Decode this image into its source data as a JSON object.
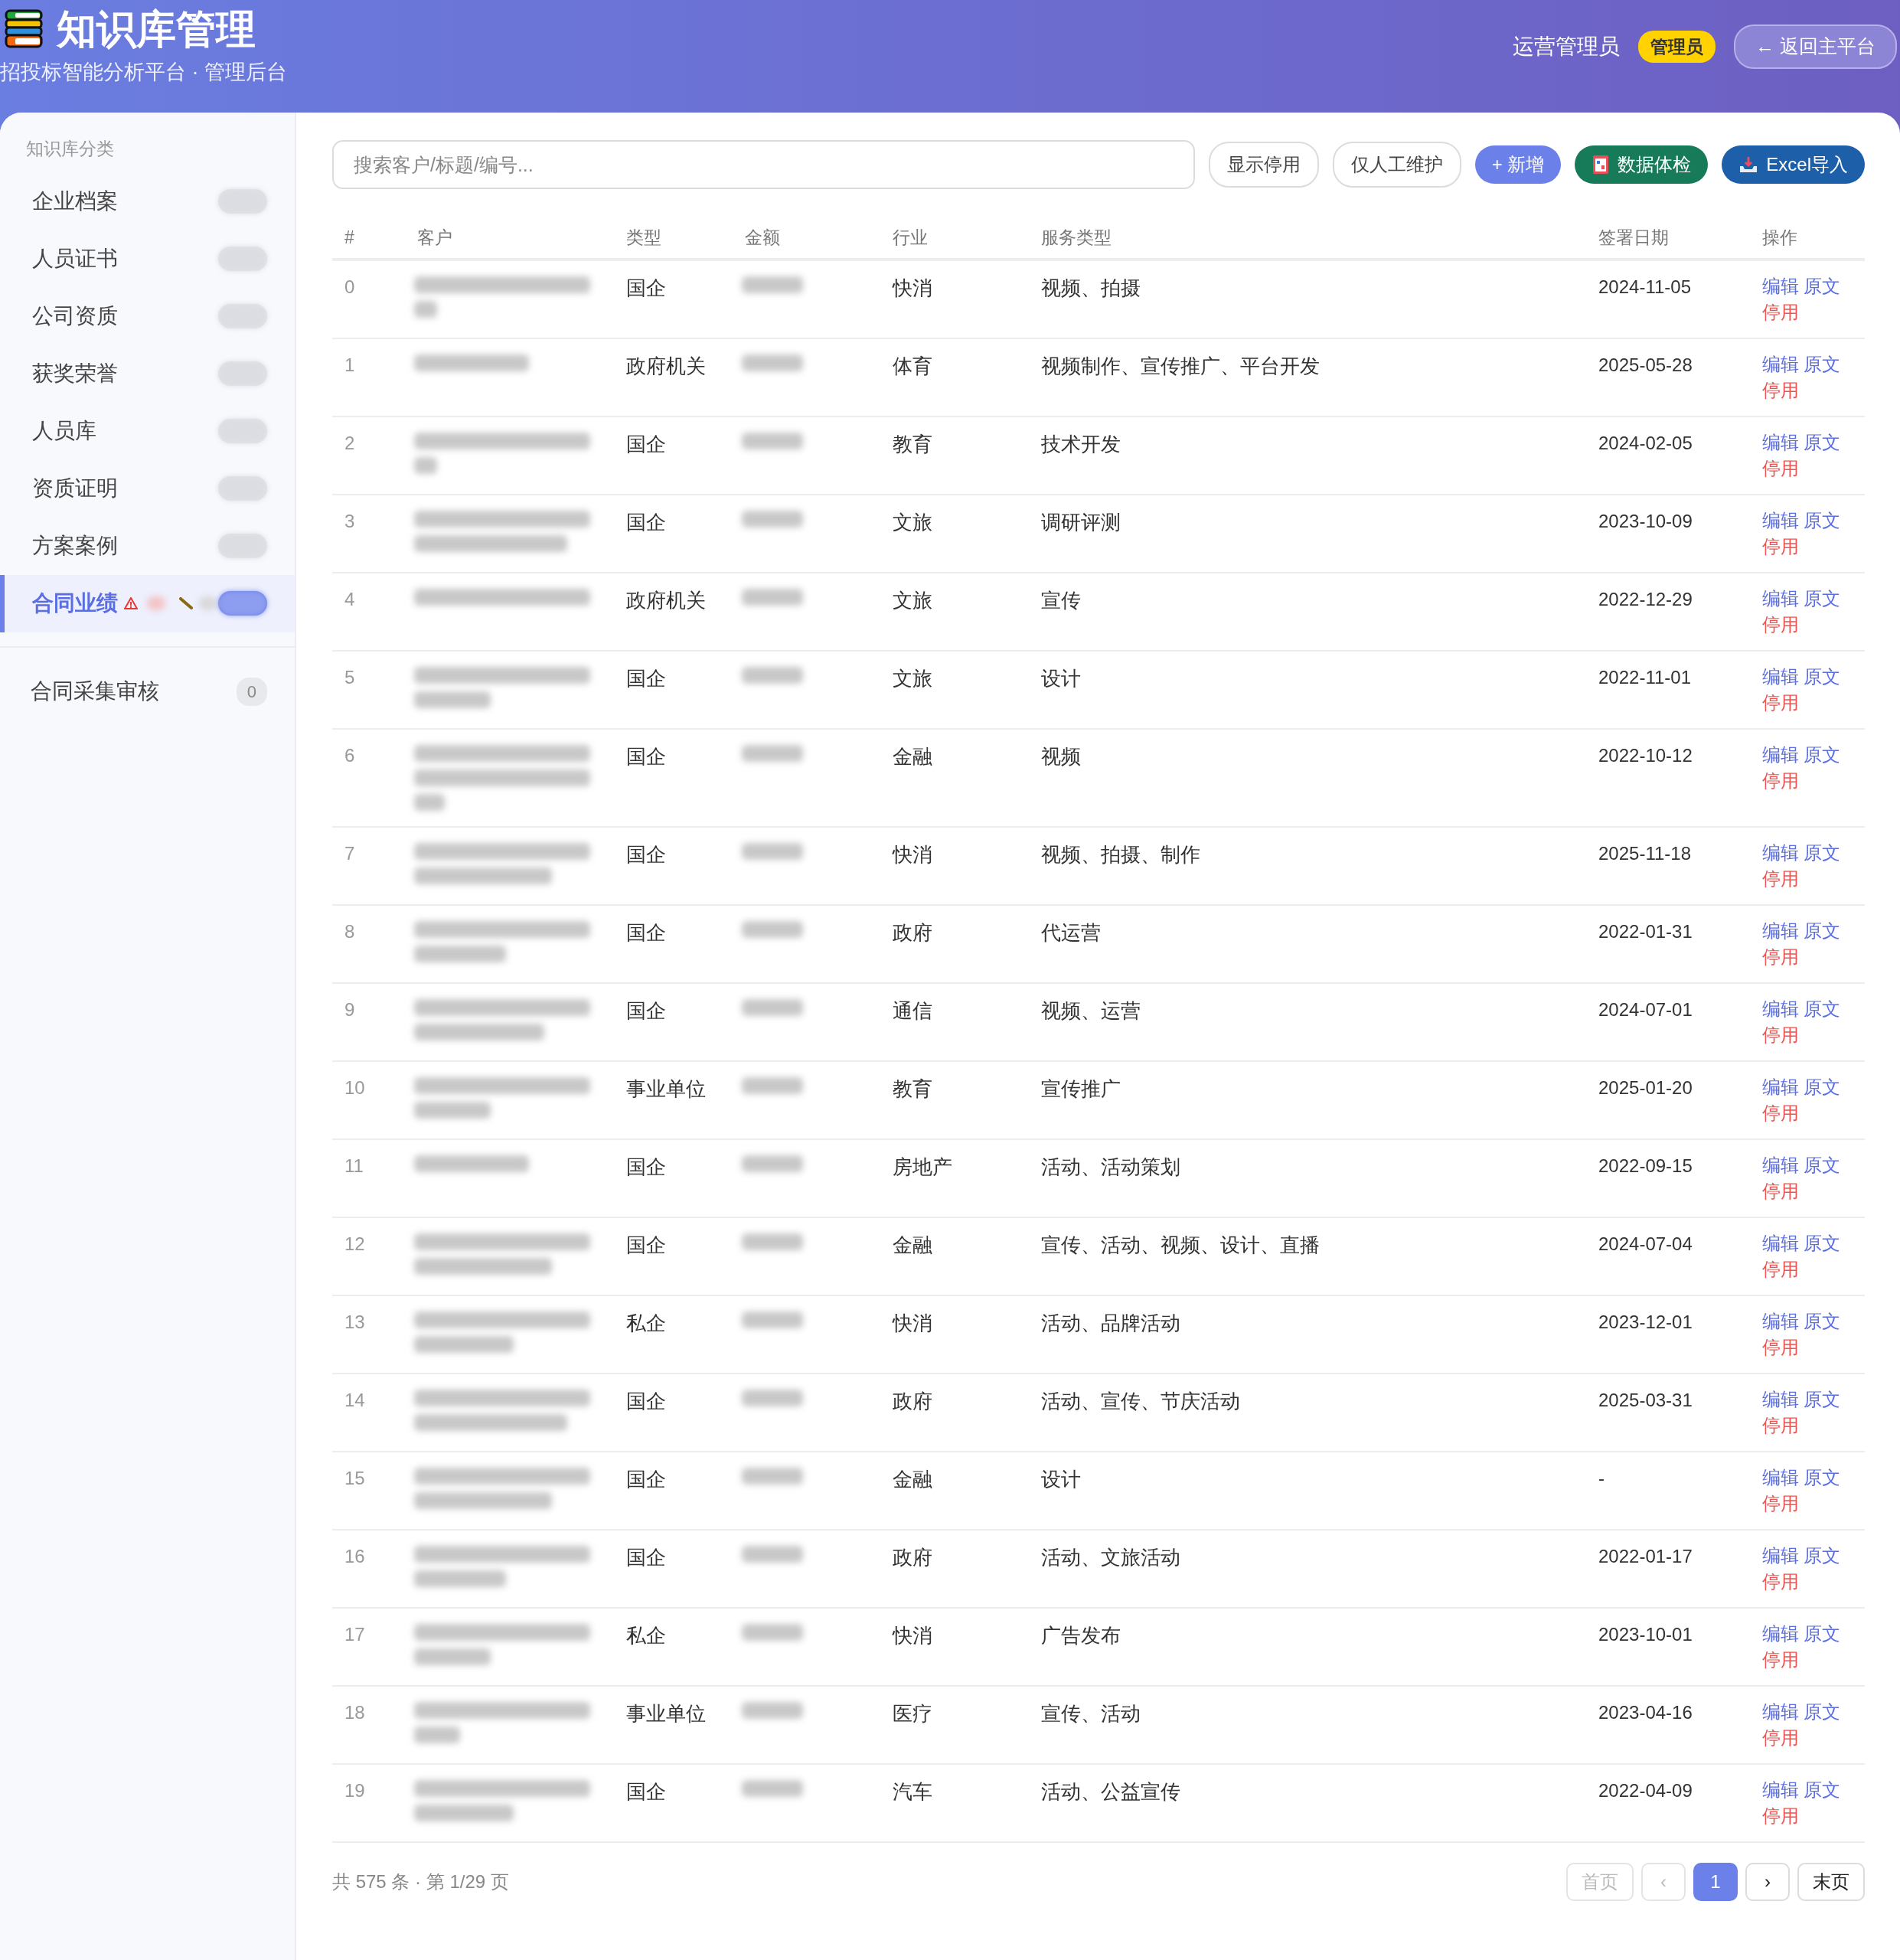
{
  "header": {
    "title": "知识库管理",
    "subtitle": "招投标智能分析平台 · 管理后台",
    "user": "运营管理员",
    "role_badge": "管理员",
    "back_button": "← 返回主平台"
  },
  "sidebar": {
    "heading": "知识库分类",
    "items": [
      {
        "label": "企业档案",
        "selected": false,
        "alert": false
      },
      {
        "label": "人员证书",
        "selected": false,
        "alert": false
      },
      {
        "label": "公司资质",
        "selected": false,
        "alert": false
      },
      {
        "label": "获奖荣誉",
        "selected": false,
        "alert": false
      },
      {
        "label": "人员库",
        "selected": false,
        "alert": false
      },
      {
        "label": "资质证明",
        "selected": false,
        "alert": false
      },
      {
        "label": "方案案例",
        "selected": false,
        "alert": false
      },
      {
        "label": "合同业绩",
        "selected": true,
        "alert": true
      }
    ],
    "review": {
      "label": "合同采集审核",
      "count": "0"
    }
  },
  "toolbar": {
    "search": {
      "placeholder": "搜索客户/标题/编号..."
    },
    "buttons": [
      {
        "label": "显示停用",
        "kind": "outline"
      },
      {
        "label": "仅人工维护",
        "kind": "outline"
      },
      {
        "label": "+ 新增",
        "kind": "primary"
      },
      {
        "label": "数据体检",
        "kind": "check"
      },
      {
        "label": "Excel导入",
        "kind": "import"
      }
    ]
  },
  "table": {
    "columns": [
      "#",
      "客户",
      "类型",
      "金额",
      "行业",
      "服务类型",
      "签署日期",
      "操作"
    ],
    "rows": [
      {
        "index": "0",
        "type": "国企",
        "industry": "快消",
        "service": "视频、拍摄",
        "date": "2024-11-05",
        "actions": [
          {
            "label": "编辑",
            "kind": "link"
          },
          {
            "label": "原文",
            "kind": "link"
          },
          {
            "label": "停用",
            "kind": "danger"
          }
        ]
      },
      {
        "index": "1",
        "type": "政府机关",
        "industry": "体育",
        "service": "视频制作、宣传推广、平台开发",
        "date": "2025-05-28",
        "actions": [
          {
            "label": "编辑",
            "kind": "link"
          },
          {
            "label": "原文",
            "kind": "link"
          },
          {
            "label": "停用",
            "kind": "danger"
          }
        ]
      },
      {
        "index": "2",
        "type": "国企",
        "industry": "教育",
        "service": "技术开发",
        "date": "2024-02-05",
        "actions": [
          {
            "label": "编辑",
            "kind": "link"
          },
          {
            "label": "原文",
            "kind": "link"
          },
          {
            "label": "停用",
            "kind": "danger"
          }
        ]
      },
      {
        "index": "3",
        "type": "国企",
        "industry": "文旅",
        "service": "调研评测",
        "date": "2023-10-09",
        "actions": [
          {
            "label": "编辑",
            "kind": "link"
          },
          {
            "label": "原文",
            "kind": "link"
          },
          {
            "label": "停用",
            "kind": "danger"
          }
        ]
      },
      {
        "index": "4",
        "type": "政府机关",
        "industry": "文旅",
        "service": "宣传",
        "date": "2022-12-29",
        "actions": [
          {
            "label": "编辑",
            "kind": "link"
          },
          {
            "label": "原文",
            "kind": "link"
          },
          {
            "label": "停用",
            "kind": "danger"
          }
        ]
      },
      {
        "index": "5",
        "type": "国企",
        "industry": "文旅",
        "service": "设计",
        "date": "2022-11-01",
        "actions": [
          {
            "label": "编辑",
            "kind": "link"
          },
          {
            "label": "原文",
            "kind": "link"
          },
          {
            "label": "停用",
            "kind": "danger"
          }
        ]
      },
      {
        "index": "6",
        "type": "国企",
        "industry": "金融",
        "service": "视频",
        "date": "2022-10-12",
        "actions": [
          {
            "label": "编辑",
            "kind": "link"
          },
          {
            "label": "原文",
            "kind": "link"
          },
          {
            "label": "停用",
            "kind": "danger"
          }
        ]
      },
      {
        "index": "7",
        "type": "国企",
        "industry": "快消",
        "service": "视频、拍摄、制作",
        "date": "2025-11-18",
        "actions": [
          {
            "label": "编辑",
            "kind": "link"
          },
          {
            "label": "原文",
            "kind": "link"
          },
          {
            "label": "停用",
            "kind": "danger"
          }
        ]
      },
      {
        "index": "8",
        "type": "国企",
        "industry": "政府",
        "service": "代运营",
        "date": "2022-01-31",
        "actions": [
          {
            "label": "编辑",
            "kind": "link"
          },
          {
            "label": "原文",
            "kind": "link"
          },
          {
            "label": "停用",
            "kind": "danger"
          }
        ]
      },
      {
        "index": "9",
        "type": "国企",
        "industry": "通信",
        "service": "视频、运营",
        "date": "2024-07-01",
        "actions": [
          {
            "label": "编辑",
            "kind": "link"
          },
          {
            "label": "原文",
            "kind": "link"
          },
          {
            "label": "停用",
            "kind": "danger"
          }
        ]
      },
      {
        "index": "10",
        "type": "事业单位",
        "industry": "教育",
        "service": "宣传推广",
        "date": "2025-01-20",
        "actions": [
          {
            "label": "编辑",
            "kind": "link"
          },
          {
            "label": "原文",
            "kind": "link"
          },
          {
            "label": "停用",
            "kind": "danger"
          }
        ]
      },
      {
        "index": "11",
        "type": "国企",
        "industry": "房地产",
        "service": "活动、活动策划",
        "date": "2022-09-15",
        "actions": [
          {
            "label": "编辑",
            "kind": "link"
          },
          {
            "label": "原文",
            "kind": "link"
          },
          {
            "label": "停用",
            "kind": "danger"
          }
        ]
      },
      {
        "index": "12",
        "type": "国企",
        "industry": "金融",
        "service": "宣传、活动、视频、设计、直播",
        "date": "2024-07-04",
        "actions": [
          {
            "label": "编辑",
            "kind": "link"
          },
          {
            "label": "原文",
            "kind": "link"
          },
          {
            "label": "停用",
            "kind": "danger"
          }
        ]
      },
      {
        "index": "13",
        "type": "私企",
        "industry": "快消",
        "service": "活动、品牌活动",
        "date": "2023-12-01",
        "actions": [
          {
            "label": "编辑",
            "kind": "link"
          },
          {
            "label": "原文",
            "kind": "link"
          },
          {
            "label": "停用",
            "kind": "danger"
          }
        ]
      },
      {
        "index": "14",
        "type": "国企",
        "industry": "政府",
        "service": "活动、宣传、节庆活动",
        "date": "2025-03-31",
        "actions": [
          {
            "label": "编辑",
            "kind": "link"
          },
          {
            "label": "原文",
            "kind": "link"
          },
          {
            "label": "停用",
            "kind": "danger"
          }
        ]
      },
      {
        "index": "15",
        "type": "国企",
        "industry": "金融",
        "service": "设计",
        "date": "-",
        "actions": [
          {
            "label": "编辑",
            "kind": "link"
          },
          {
            "label": "原文",
            "kind": "link"
          },
          {
            "label": "停用",
            "kind": "danger"
          }
        ]
      },
      {
        "index": "16",
        "type": "国企",
        "industry": "政府",
        "service": "活动、文旅活动",
        "date": "2022-01-17",
        "actions": [
          {
            "label": "编辑",
            "kind": "link"
          },
          {
            "label": "原文",
            "kind": "link"
          },
          {
            "label": "停用",
            "kind": "danger"
          }
        ]
      },
      {
        "index": "17",
        "type": "私企",
        "industry": "快消",
        "service": "广告发布",
        "date": "2023-10-01",
        "actions": [
          {
            "label": "编辑",
            "kind": "link"
          },
          {
            "label": "原文",
            "kind": "link"
          },
          {
            "label": "停用",
            "kind": "danger"
          }
        ]
      },
      {
        "index": "18",
        "type": "事业单位",
        "industry": "医疗",
        "service": "宣传、活动",
        "date": "2023-04-16",
        "actions": [
          {
            "label": "编辑",
            "kind": "link"
          },
          {
            "label": "原文",
            "kind": "link"
          },
          {
            "label": "停用",
            "kind": "danger"
          }
        ]
      },
      {
        "index": "19",
        "type": "国企",
        "industry": "汽车",
        "service": "活动、公益宣传",
        "date": "2022-04-09",
        "actions": [
          {
            "label": "编辑",
            "kind": "link"
          },
          {
            "label": "原文",
            "kind": "link"
          },
          {
            "label": "停用",
            "kind": "danger"
          }
        ]
      }
    ]
  },
  "pagination": {
    "summary": "共 575 条 · 第 1/29 页",
    "buttons": [
      {
        "label": "首页",
        "selected": false,
        "disabled": true
      },
      {
        "label": "‹",
        "selected": false,
        "disabled": true
      },
      {
        "label": "1",
        "selected": true,
        "disabled": false
      },
      {
        "label": "›",
        "selected": false,
        "disabled": false
      },
      {
        "label": "末页",
        "selected": false,
        "disabled": false
      }
    ]
  }
}
